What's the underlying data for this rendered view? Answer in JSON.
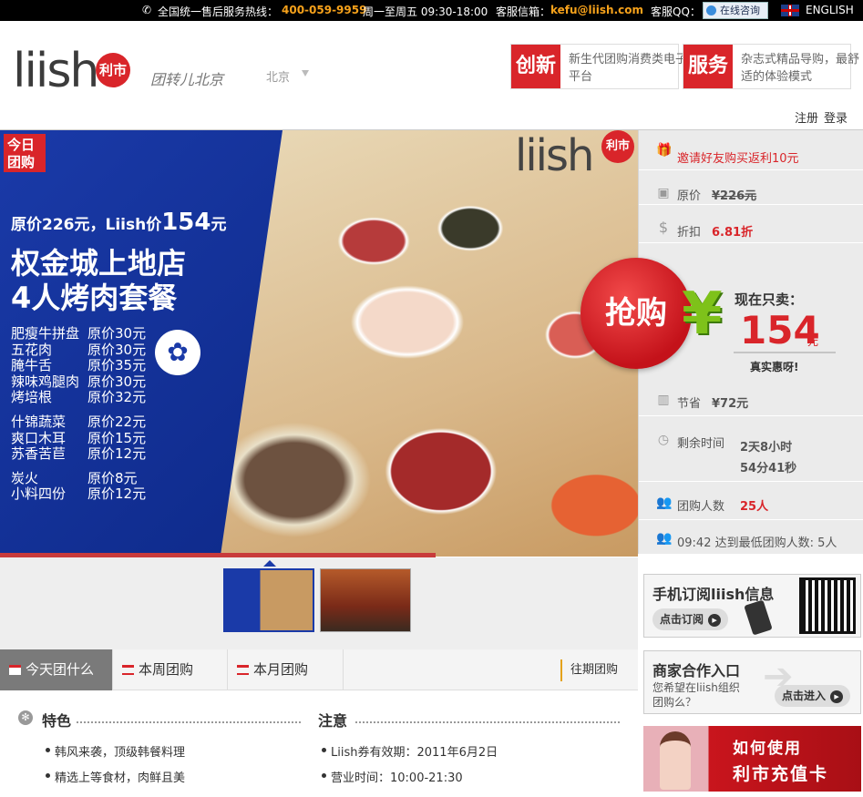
{
  "topbar": {
    "hotline_label": "全国统一售后服务热线：",
    "hotline": "400-059-9959",
    "hours": "周一至周五 09:30-18:00",
    "email_label": "客服信箱：",
    "email": "kefu@liish.com",
    "qq_label": "客服QQ：",
    "qq_button": "在线咨询",
    "language": "ENGLISH"
  },
  "header": {
    "logo": "liish",
    "logo_badge": "利市",
    "slogan": "团转儿北京",
    "city": "北京",
    "boxes": [
      {
        "tag": "创新",
        "text": "新生代团购消费类电子平台"
      },
      {
        "tag": "服务",
        "text": "杂志式精品导购，最舒适的体验模式"
      }
    ],
    "register": "注册",
    "login": "登录"
  },
  "banner": {
    "today_badge_1": "今日",
    "today_badge_2": "团购",
    "price_prefix": "原价226元，Liish价",
    "price_big": "154",
    "price_suffix": "元",
    "title_1": "权金城上地店",
    "title_2": "4人烤肉套餐",
    "menu": [
      {
        "item": "肥瘦牛拼盘",
        "price": "原价30元"
      },
      {
        "item": "五花肉",
        "price": "原价30元"
      },
      {
        "item": "腌牛舌",
        "price": "原价35元"
      },
      {
        "item": "辣味鸡腿肉",
        "price": "原价30元"
      },
      {
        "item": "烤培根",
        "price": "原价32元"
      },
      {
        "item": "什锦蔬菜",
        "price": "原价22元"
      },
      {
        "item": "爽口木耳",
        "price": "原价15元"
      },
      {
        "item": "苏香苦苣",
        "price": "原价12元"
      },
      {
        "item": "炭火",
        "price": "原价8元"
      },
      {
        "item": "小料四份",
        "price": "原价12元"
      }
    ],
    "watermark": "liish",
    "watermark_badge": "利市"
  },
  "deal": {
    "invite": "邀请好友购买返利10元",
    "original_label": "原价",
    "original_value": "¥226元",
    "discount_label": "折扣",
    "discount_value": "6.81折",
    "buy_button": "抢购",
    "yen": "¥",
    "now_label": "现在只卖：",
    "now_price": "154",
    "now_unit": "元",
    "now_sub": "真实惠呀!",
    "save_label": "节省",
    "save_value": "¥72元",
    "remain_label": "剩余时间",
    "remain_line1": "2天8小时",
    "remain_line2": "54分41秒",
    "buyers_label": "团购人数",
    "buyers_value": "25人",
    "reached": "09:42 达到最低团购人数: 5人"
  },
  "tabs": {
    "today": "今天团什么",
    "week": "本周团购",
    "month": "本月团购",
    "past": "往期团购"
  },
  "content": {
    "feature_title": "特色",
    "features": [
      "韩风来袭，顶级韩餐料理",
      "精选上等食材，肉鲜且美"
    ],
    "notice_title": "注意",
    "notices": [
      "Liish券有效期：2011年6月2日",
      "营业时间：10:00-21:30"
    ]
  },
  "side": {
    "subscribe_title": "手机订阅liish信息",
    "subscribe_button": "点击订阅",
    "partner_title": "商家合作入口",
    "partner_text": "您希望在liish组织团购么？",
    "partner_button": "点击进入",
    "card_line1": "如何使用",
    "card_line2": "利市充值卡"
  }
}
